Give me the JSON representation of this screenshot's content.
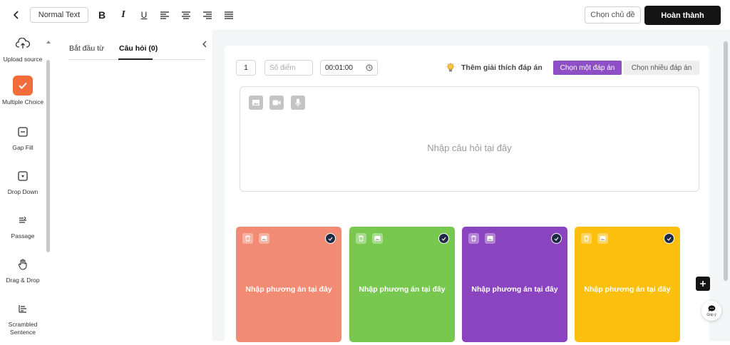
{
  "toolbar": {
    "text_style": "Normal Text",
    "choose_topic_label": "Chọn chủ đề",
    "done_label": "Hoàn thành",
    "bold_label": "B",
    "italic_label": "I",
    "underline_label": "U"
  },
  "sidebar": {
    "items": [
      {
        "label": "Upload source",
        "icon": "cloud-upload-icon"
      },
      {
        "label": "Multiple Choice",
        "icon": "check-square-icon"
      },
      {
        "label": "Gap Fill",
        "icon": "minus-square-icon"
      },
      {
        "label": "Drop Down",
        "icon": "dropdown-square-icon"
      },
      {
        "label": "Passage",
        "icon": "text-lines-icon"
      },
      {
        "label": "Drag & Drop",
        "icon": "hand-icon"
      },
      {
        "label": "Scrambled Sentence",
        "icon": "align-icon"
      }
    ],
    "accent": "#f26b3a"
  },
  "question_panel": {
    "tab_start": "Bắt đầu từ",
    "tab_questions": "Câu hỏi (0)"
  },
  "editor": {
    "question_number": "1",
    "score_placeholder": "Số điểm",
    "time_value": "00:01:00",
    "explain_label": "Thêm giải thích đáp án",
    "single_choice_label": "Chọn một đáp án",
    "multi_choice_label": "Chọn nhiều đáp án",
    "question_placeholder": "Nhập câu hỏi tại đây",
    "accent": "#8e4fc5"
  },
  "answers": [
    {
      "placeholder": "Nhập phương án tại đây",
      "color": "#f28b73"
    },
    {
      "placeholder": "Nhập phương án tại đây",
      "color": "#78c850"
    },
    {
      "placeholder": "Nhập phương án tại đây",
      "color": "#8a44bf"
    },
    {
      "placeholder": "Nhập phương án tại đây",
      "color": "#fcbf0e"
    }
  ],
  "feedback": {
    "label": "Góp ý"
  }
}
